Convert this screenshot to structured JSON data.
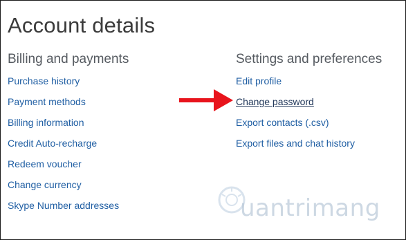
{
  "page": {
    "title": "Account details"
  },
  "billing": {
    "title": "Billing and payments",
    "links": [
      "Purchase history",
      "Payment methods",
      "Billing information",
      "Credit Auto-recharge",
      "Redeem voucher",
      "Change currency",
      "Skype Number addresses"
    ]
  },
  "settings": {
    "title": "Settings and preferences",
    "links": [
      "Edit profile",
      "Change password",
      "Export contacts (.csv)",
      "Export files and chat history"
    ]
  },
  "annotation": {
    "arrow_color": "#e8141c",
    "points_to": "Change password"
  },
  "watermark": {
    "text": "uantrimang"
  },
  "colors": {
    "link": "#1f5ea3",
    "title": "#3b3b3b",
    "section": "#555a60"
  }
}
